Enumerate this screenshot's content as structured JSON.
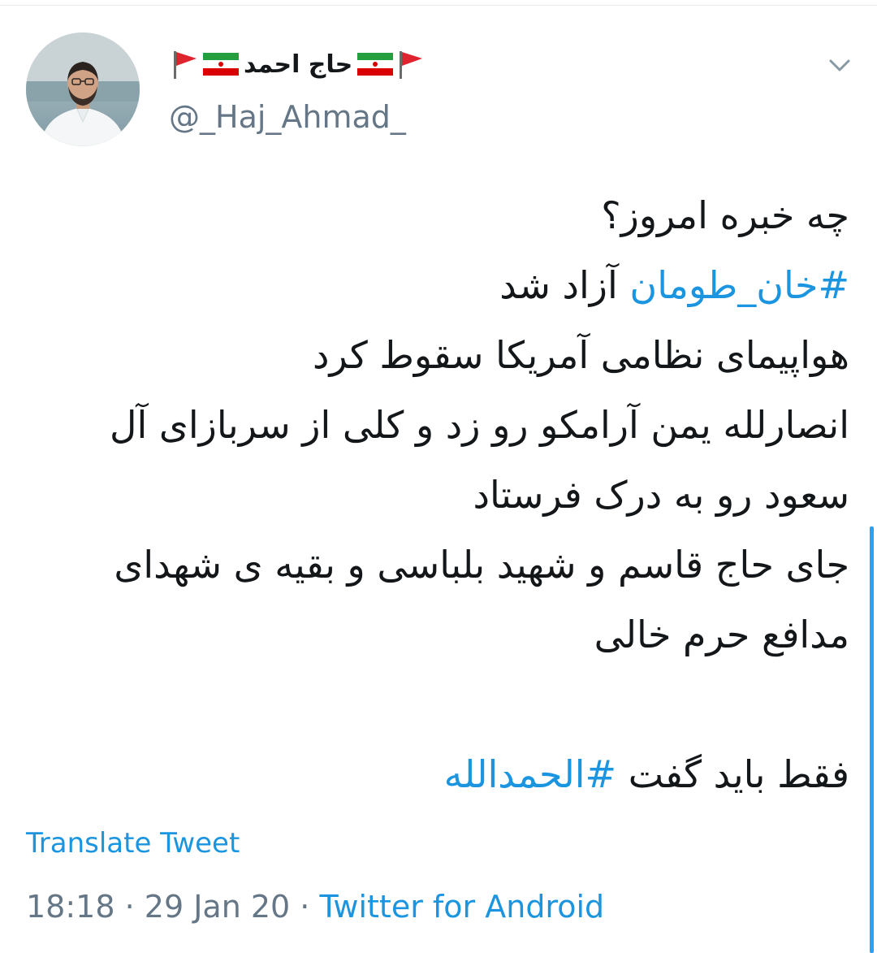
{
  "author": {
    "display_name": "حاج احمد",
    "handle": "@_Haj_Ahmad_"
  },
  "icons": {
    "avatar": "profile-photo",
    "name_left_decoration": [
      "red-pennant-flag-icon",
      "iran-flag-icon"
    ],
    "name_right_decoration": [
      "iran-flag-icon",
      "red-pennant-flag-icon"
    ],
    "menu": "chevron-down-icon"
  },
  "tweet": {
    "line1": "چه خبره امروز؟",
    "line2_hashtag": "#خان_طومان",
    "line2_rest": " آزاد شد",
    "line3": "هواپیمای نظامی آمریکا سقوط کرد",
    "line4": "انصارلله یمن آرامکو رو زد و کلی از سربازای آل",
    "line5": "سعود رو به درک فرستاد",
    "line6": "جای حاج قاسم و شهید بلباسی و بقیه ی شهدای",
    "line7": "مدافع حرم خالی",
    "line9_text": "فقط باید گفت ",
    "line9_hashtag": "#الحمدالله"
  },
  "translate_label": "Translate Tweet",
  "meta": {
    "time": "18:18",
    "separator": " · ",
    "date": "29 Jan 20",
    "source": "Twitter for Android"
  },
  "colors": {
    "link": "#1b95e0",
    "secondary_text": "#657786",
    "primary_text": "#14171a"
  }
}
